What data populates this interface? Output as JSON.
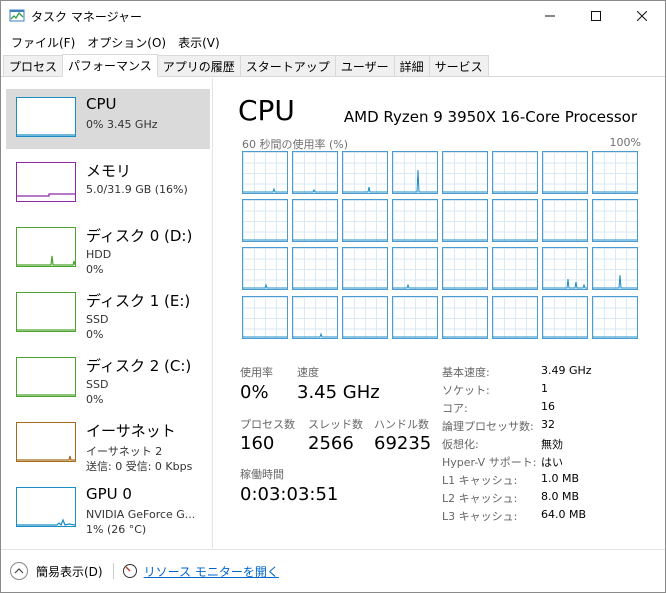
{
  "window": {
    "title": "タスク マネージャー",
    "minimize_glyph": "—",
    "maximize_glyph": "☐",
    "close_glyph": "✕"
  },
  "menu": [
    "ファイル(F)",
    "オプション(O)",
    "表示(V)"
  ],
  "tabs": [
    {
      "label": "プロセス",
      "active": false
    },
    {
      "label": "パフォーマンス",
      "active": true
    },
    {
      "label": "アプリの履歴",
      "active": false
    },
    {
      "label": "スタートアップ",
      "active": false
    },
    {
      "label": "ユーザー",
      "active": false
    },
    {
      "label": "詳細",
      "active": false
    },
    {
      "label": "サービス",
      "active": false
    }
  ],
  "sidebar": [
    {
      "title": "CPU",
      "line1": "0%  3.45 GHz",
      "line2": "",
      "color": "#1a8cc6",
      "selected": true
    },
    {
      "title": "メモリ",
      "line1": "5.0/31.9 GB (16%)",
      "line2": "",
      "color": "#8b29a6",
      "selected": false
    },
    {
      "title": "ディスク 0 (D:)",
      "line1": "HDD",
      "line2": "0%",
      "color": "#4da32e",
      "selected": false
    },
    {
      "title": "ディスク 1 (E:)",
      "line1": "SSD",
      "line2": "0%",
      "color": "#4da32e",
      "selected": false
    },
    {
      "title": "ディスク 2 (C:)",
      "line1": "SSD",
      "line2": "0%",
      "color": "#4da32e",
      "selected": false
    },
    {
      "title": "イーサネット",
      "line1": "イーサネット 2",
      "line2": "送信: 0 受信: 0 Kbps",
      "color": "#a76a1a",
      "selected": false
    },
    {
      "title": "GPU 0",
      "line1": "NVIDIA GeForce G...",
      "line2": "1% (26 °C)",
      "color": "#1a8cc6",
      "selected": false
    }
  ],
  "main": {
    "title": "CPU",
    "processor": "AMD Ryzen 9 3950X 16-Core Processor",
    "graph_caption": "60 秒間の使用率 (%)",
    "graph_max": "100%",
    "stats": {
      "utilization_label": "使用率",
      "utilization_value": "0%",
      "speed_label": "速度",
      "speed_value": "3.45 GHz",
      "processes_label": "プロセス数",
      "processes_value": "160",
      "threads_label": "スレッド数",
      "threads_value": "2566",
      "handles_label": "ハンドル数",
      "handles_value": "69235",
      "uptime_label": "稼働時間",
      "uptime_value": "0:03:03:51"
    },
    "specs": [
      {
        "label": "基本速度:",
        "value": "3.49 GHz"
      },
      {
        "label": "ソケット:",
        "value": "1"
      },
      {
        "label": "コア:",
        "value": "16"
      },
      {
        "label": "論理プロセッサ数:",
        "value": "32"
      },
      {
        "label": "仮想化:",
        "value": "無効"
      },
      {
        "label": "Hyper-V サポート:",
        "value": "はい"
      },
      {
        "label": "L1 キャッシュ:",
        "value": "1.0 MB"
      },
      {
        "label": "L2 キャッシュ:",
        "value": "8.0 MB"
      },
      {
        "label": "L3 キャッシュ:",
        "value": "64.0 MB"
      }
    ]
  },
  "bottom": {
    "fewer_details": "簡易表示(D)",
    "resource_monitor": "リソース モニターを開く"
  },
  "colors": {
    "cpu": "#1a8cc6",
    "memory": "#8b29a6",
    "disk": "#4da32e",
    "ethernet": "#a76a1a",
    "gpu": "#1a8cc6",
    "link": "#0066cc"
  }
}
